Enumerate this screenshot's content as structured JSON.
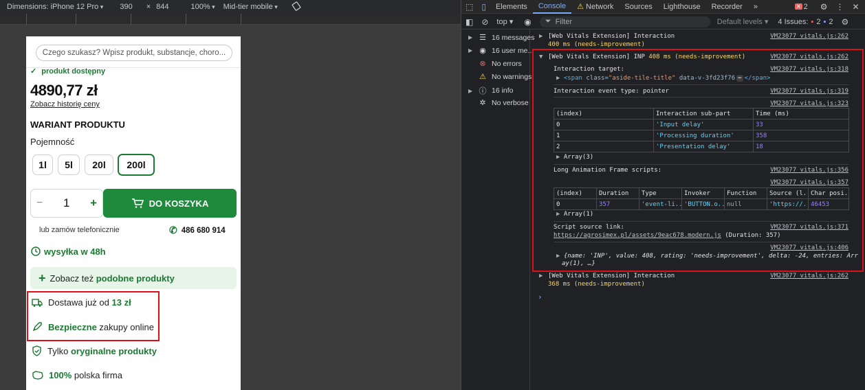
{
  "device_bar": {
    "dimensions_label": "Dimensions: iPhone 12 Pro",
    "width": "390",
    "times": "×",
    "height": "844",
    "zoom": "100%",
    "throttle": "Mid-tier mobile"
  },
  "page": {
    "search_placeholder": "Czego szukasz? Wpisz produkt, substancje, choro...",
    "availability": "produkt dostępny",
    "price": "4890,77 zł",
    "price_history": "Zobacz historię ceny",
    "variant_title": "WARIANT PRODUKTU",
    "capacity_label": "Pojemność",
    "variants": [
      "1l",
      "5l",
      "20l",
      "200l"
    ],
    "selected_variant": "200l",
    "qty_minus": "−",
    "qty_value": "1",
    "qty_plus": "+",
    "add_to_cart": "DO KOSZYKA",
    "phone_order": "lub zamów telefonicznie",
    "phone_number": "486 680 914",
    "shipping": "wysyłka w 48h",
    "similar_prefix": "Zobacz też ",
    "similar_bold": "podobne produkty",
    "delivery_prefix": "Dostawa już od ",
    "delivery_bold": "13 zł",
    "safe_bold": "Bezpieczne",
    "safe_suffix": " zakupy online",
    "orig_prefix": "Tylko ",
    "orig_bold": "oryginalne produkty",
    "polish_bold": "100%",
    "polish_suffix": " polska firma"
  },
  "devtools": {
    "tabs": [
      "Elements",
      "Console",
      "Network",
      "Sources",
      "Lighthouse",
      "Recorder"
    ],
    "active_tab": "Console",
    "more_tabs": "»",
    "error_count": "2",
    "issues_label": "4 Issues:",
    "issues_errors": "2",
    "issues_info": "2",
    "context": "top",
    "filter_placeholder": "Filter",
    "levels": "Default levels",
    "sidebar": [
      {
        "label": "16 messages",
        "icon": "list-icon"
      },
      {
        "label": "16 user me...",
        "icon": "user-icon"
      },
      {
        "label": "No errors",
        "icon": "error-icon"
      },
      {
        "label": "No warnings",
        "icon": "warning-icon"
      },
      {
        "label": "16 info",
        "icon": "info-icon"
      },
      {
        "label": "No verbose",
        "icon": "verbose-icon"
      }
    ],
    "console": {
      "msg1_title": "[Web Vitals Extension] Interaction",
      "msg1_value": "400 ms (needs-improvement)",
      "msg1_src": "VM23077 vitals.js:262",
      "inp_prefix": "[Web Vitals Extension] INP ",
      "inp_value": "408 ms (needs-improvement)",
      "inp_src": "VM23077 vitals.js:262",
      "target_label": "Interaction target:",
      "target_src": "VM23077 vitals.js:318",
      "target_tag_open": "<span ",
      "target_attr": "class=",
      "target_attr_value": "\"aside-tile-title\"",
      "target_data": " data-v-3fd23f76",
      "target_ellipsis": "⋯",
      "target_tag_close": "</span>",
      "event_type": "Interaction event type: pointer",
      "event_src": "VM23077 vitals.js:319",
      "table1_src": "VM23077 vitals.js:323",
      "table1_headers": [
        "(index)",
        "Interaction sub-part",
        "Time (ms)"
      ],
      "table1_rows": [
        [
          "0",
          "'Input delay'",
          "33"
        ],
        [
          "1",
          "'Processing duration'",
          "358"
        ],
        [
          "2",
          "'Presentation delay'",
          "18"
        ]
      ],
      "array3": "Array(3)",
      "loaf_label": "Long Animation Frame scripts:",
      "loaf_src": "VM23077 vitals.js:356",
      "table2_src": "VM23077 vitals.js:357",
      "table2_headers": [
        "(index)",
        "Duration",
        "Type",
        "Invoker",
        "Function",
        "Source (l...",
        "Char posi..."
      ],
      "table2_row": [
        "0",
        "357",
        "'event-li...",
        "'BUTTON.o...",
        "null",
        "'https://...",
        "46453"
      ],
      "array1": "Array(1)",
      "script_label": "Script source link:",
      "script_src": "VM23077 vitals.js:371",
      "script_link": "https://agrosimex.pl/assets/9eac678.modern.js",
      "script_duration": " (Duration: 357)",
      "obj_src": "VM23077 vitals.js:406",
      "obj_line1": "{name: 'INP', value: 408, rating: 'needs-improvement', delta: -24, entries: Arr",
      "obj_line2": "ay(1), …}",
      "msg3_title": "[Web Vitals Extension] Interaction",
      "msg3_value": "368 ms (needs-improvement)",
      "msg3_src": "VM23077 vitals.js:262",
      "prompt": "›"
    }
  },
  "colors": {
    "brand_green": "#1b7a32",
    "highlight_red": "#e0101a",
    "warning_yellow": "#fdd663"
  }
}
